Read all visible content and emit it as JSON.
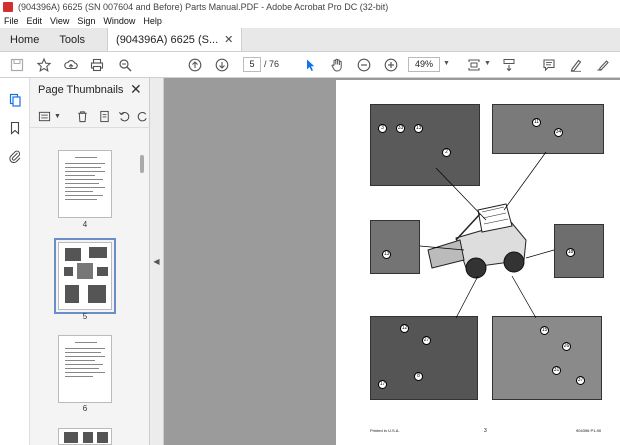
{
  "window": {
    "title": "(904396A) 6625 (SN 007604 and Before) Parts Manual.PDF - Adobe Acrobat Pro DC (32-bit)"
  },
  "menu": [
    "File",
    "Edit",
    "View",
    "Sign",
    "Window",
    "Help"
  ],
  "tabs": {
    "home": "Home",
    "tools": "Tools",
    "document": "(904396A) 6625 (S...",
    "close": "✕"
  },
  "toolbar": {
    "current_page": "5",
    "total_pages": "/ 76",
    "zoom": "49%"
  },
  "panel": {
    "title": "Page Thumbnails",
    "close": "✕",
    "thumbnails": [
      {
        "label": "4"
      },
      {
        "label": "5"
      },
      {
        "label": "6"
      }
    ]
  },
  "document_page": {
    "footer_left": "Printed in U.S.A.",
    "footer_center": "3",
    "footer_right": "904396 P1-90",
    "callouts": [
      "3",
      "33",
      "13",
      "2",
      "11",
      "34",
      "13",
      "18",
      "12",
      "27",
      "17",
      "8",
      "15",
      "26",
      "31",
      "37"
    ]
  },
  "colors": {
    "accent": "#1473e6",
    "viewer_bg": "#9b9b9b",
    "selection": "#6a8fc8"
  }
}
